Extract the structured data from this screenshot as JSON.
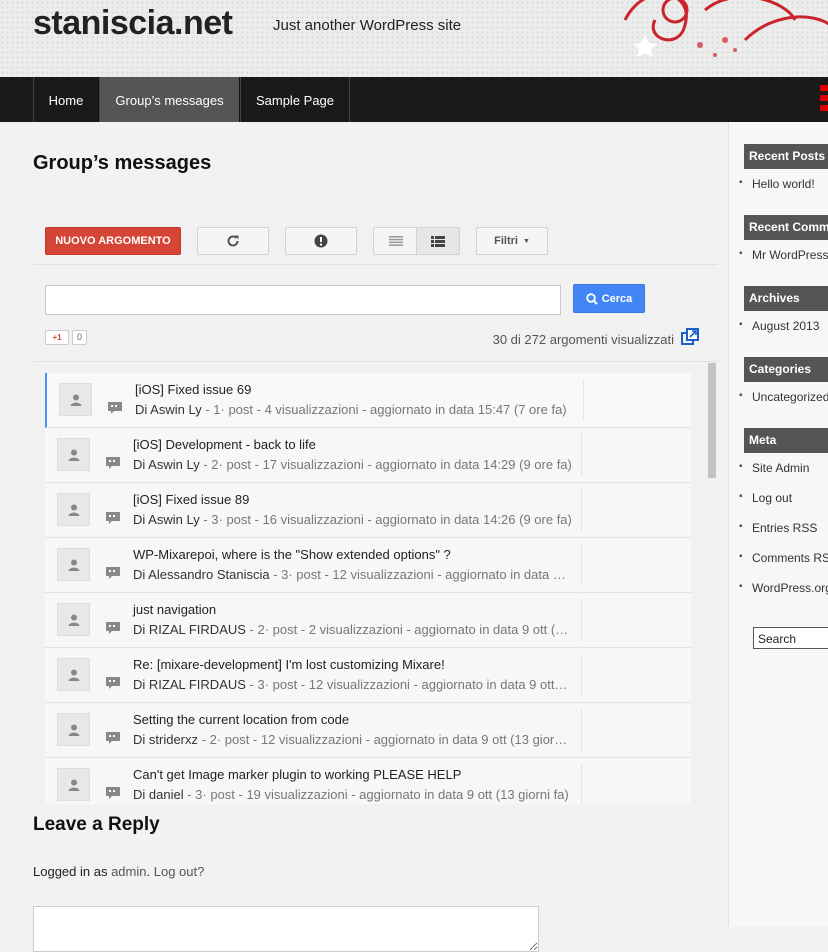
{
  "site": {
    "title": "staniscia.net",
    "tagline": "Just another WordPress site",
    "accent": "#d44535"
  },
  "nav": {
    "items": [
      {
        "label": "Home"
      },
      {
        "label": "Group’s messages"
      },
      {
        "label": "Sample Page"
      }
    ],
    "active_index": 1
  },
  "page": {
    "title": "Group’s messages"
  },
  "forum": {
    "new_topic_label": "NUOVO ARGOMENTO",
    "filter_label": "Filtri",
    "search_placeholder": "",
    "search_label": "Cerca",
    "gplus_label": "+1",
    "gplus_count": "0",
    "count_text": "30 di 272 argomenti visualizzati",
    "topics": [
      {
        "title": "[iOS] Fixed issue 69",
        "author": "Di Aswin Ly",
        "meta": " - 1· post - 4 visualizzazioni - aggiornato in data 15:47 (7 ore fa)"
      },
      {
        "title": "[iOS] Development - back to life",
        "author": "Di Aswin Ly",
        "meta": " - 2· post - 17 visualizzazioni - aggiornato in data 14:29 (9 ore fa)"
      },
      {
        "title": "[iOS] Fixed issue 89",
        "author": "Di Aswin Ly",
        "meta": " - 3· post - 16 visualizzazioni - aggiornato in data 14:26 (9 ore fa)"
      },
      {
        "title": "WP-Mixarepoi, where is the \"Show extended options\" ?",
        "author": "Di Alessandro Staniscia",
        "meta": " - 3· post - 12 visualizzazioni - aggiornato in data …"
      },
      {
        "title": "just navigation",
        "author": "Di RIZAL FIRDAUS",
        "meta": " - 2· post - 2 visualizzazioni - aggiornato in data 9 ott (…"
      },
      {
        "title": "Re: [mixare-development] I'm lost customizing Mixare!",
        "author": "Di RIZAL FIRDAUS",
        "meta": " - 3· post - 12 visualizzazioni - aggiornato in data 9 ott…"
      },
      {
        "title": "Setting the current location from code",
        "author": "Di striderxz",
        "meta": " - 2· post - 12 visualizzazioni - aggiornato in data 9 ott (13 gior…"
      },
      {
        "title": "Can't get Image marker plugin to working PLEASE HELP",
        "author": "Di daniel",
        "meta": " - 3· post - 19 visualizzazioni - aggiornato in data 9 ott (13 giorni fa)"
      }
    ]
  },
  "reply": {
    "title": "Leave a Reply",
    "logged_prefix": "Logged in as ",
    "user": "admin",
    "sep": ". ",
    "logout": "Log out?"
  },
  "sidebar": {
    "recent_posts": {
      "title": "Recent Posts",
      "items": [
        "Hello world!"
      ]
    },
    "recent_comments": {
      "title": "Recent Comments",
      "items": [
        "Mr WordPress"
      ]
    },
    "archives": {
      "title": "Archives",
      "items": [
        "August 2013"
      ]
    },
    "categories": {
      "title": "Categories",
      "items": [
        "Uncategorized"
      ]
    },
    "meta": {
      "title": "Meta",
      "items": [
        "Site Admin",
        "Log out",
        "Entries RSS",
        "Comments RSS",
        "WordPress.org"
      ]
    },
    "search_label": "Search"
  }
}
